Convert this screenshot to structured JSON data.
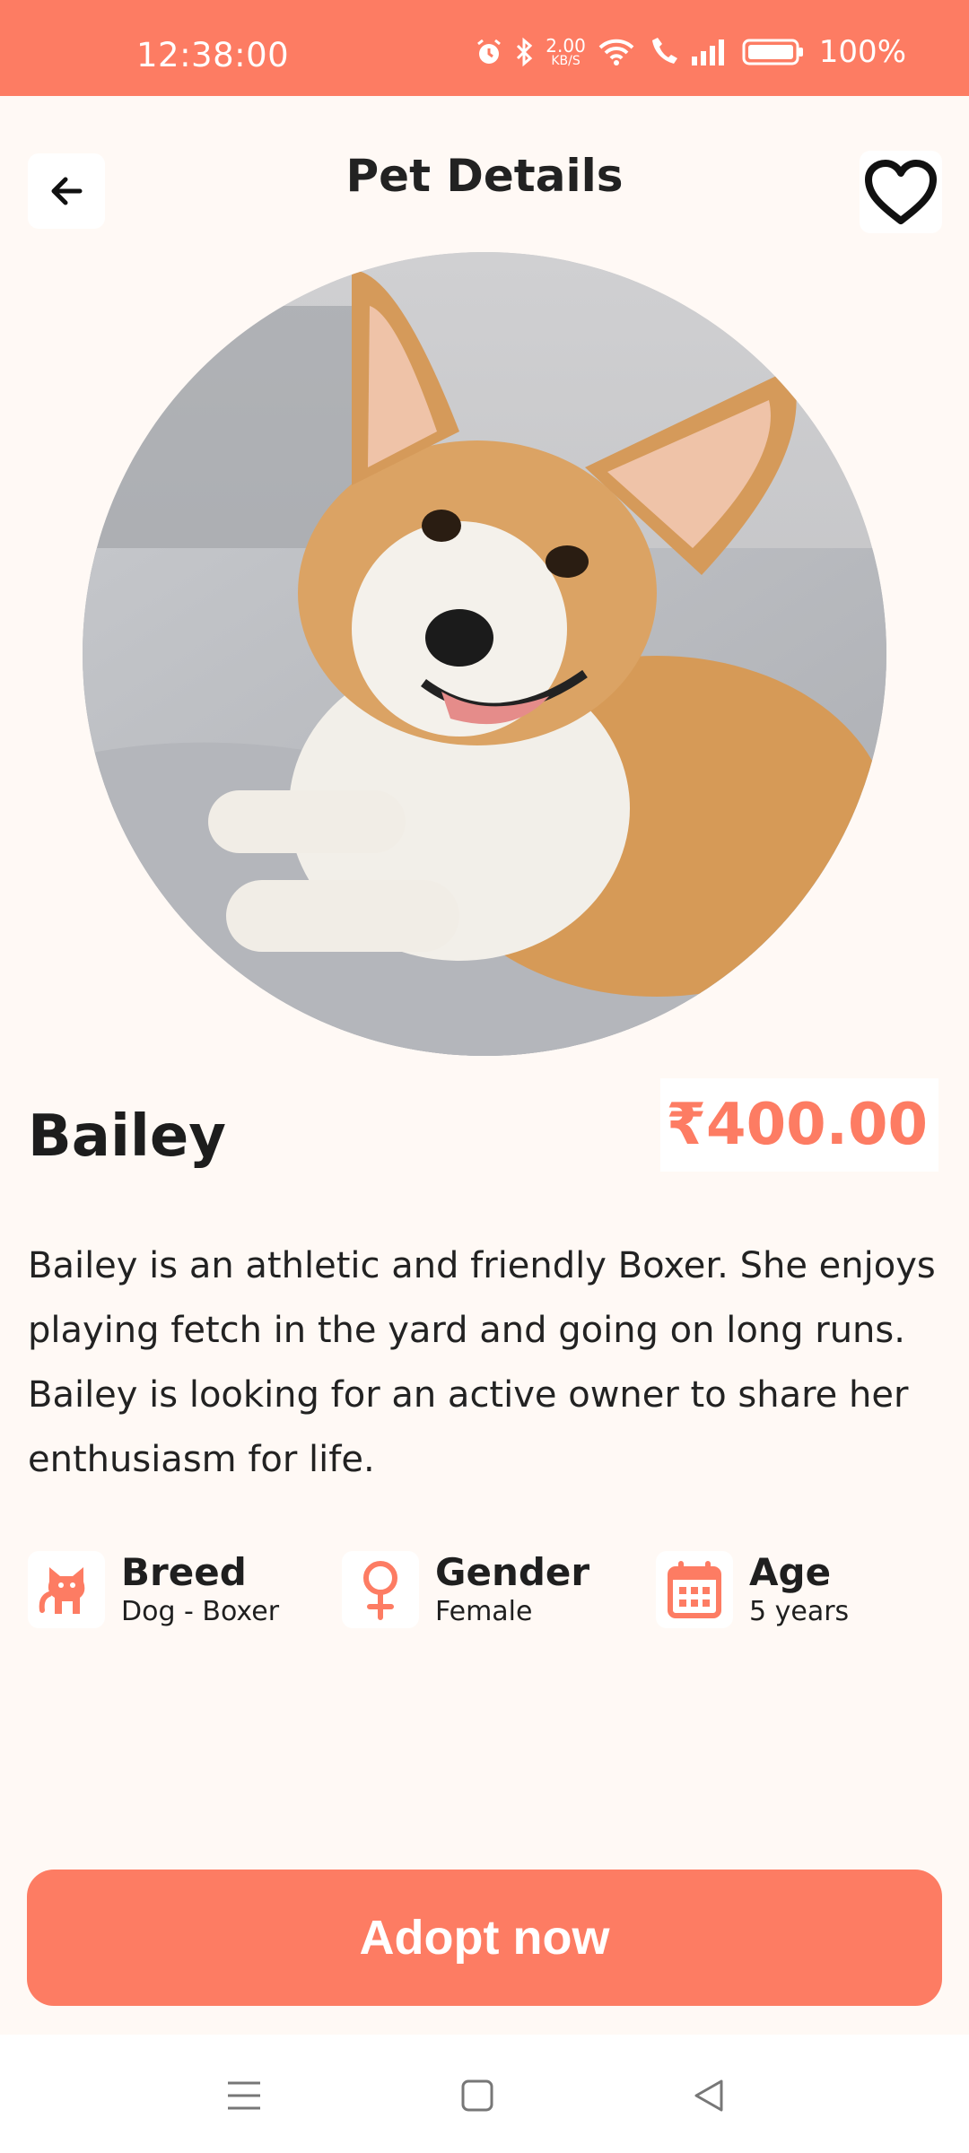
{
  "status_bar": {
    "time": "12:38:00",
    "speed_value": "2.00",
    "speed_unit": "KB/S",
    "battery": "100%",
    "icons": [
      "alarm-icon",
      "bluetooth-icon",
      "wifi-icon",
      "wifi-call-icon",
      "signal-icon",
      "battery-icon"
    ]
  },
  "header": {
    "title": "Pet Details",
    "back_icon": "arrow-left-icon",
    "favorite_icon": "heart-outline-icon"
  },
  "pet": {
    "name": "Bailey",
    "price": "₹400.00",
    "description": "Bailey is an athletic and friendly Boxer. She enjoys playing fetch in the yard and going on long runs. Bailey is looking for an active owner to share her enthusiasm for life."
  },
  "info": [
    {
      "label": "Breed",
      "value": "Dog - Boxer",
      "icon": "cat-icon"
    },
    {
      "label": "Gender",
      "value": "Female",
      "icon": "female-icon"
    },
    {
      "label": "Age",
      "value": "5 years",
      "icon": "calendar-icon"
    }
  ],
  "actions": {
    "adopt_label": "Adopt now"
  },
  "navbar": {
    "icons": [
      "menu-icon",
      "home-square-icon",
      "back-triangle-icon"
    ]
  },
  "colors": {
    "accent": "#fd7c63",
    "background": "#fff9f5",
    "text": "#1f1f1f"
  }
}
